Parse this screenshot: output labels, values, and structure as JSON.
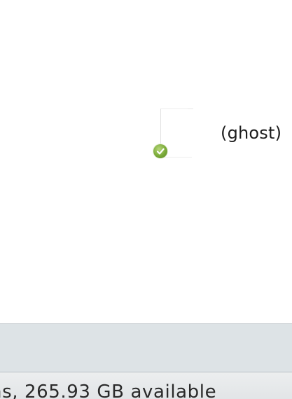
{
  "window": {
    "item": {
      "name": "(ghost)",
      "icon": "blank-document-icon",
      "badge_icon": "sync-check-icon",
      "badge_color": "#7aaa38"
    },
    "status_bar": {
      "text": "ns, 265.93 GB available"
    }
  }
}
